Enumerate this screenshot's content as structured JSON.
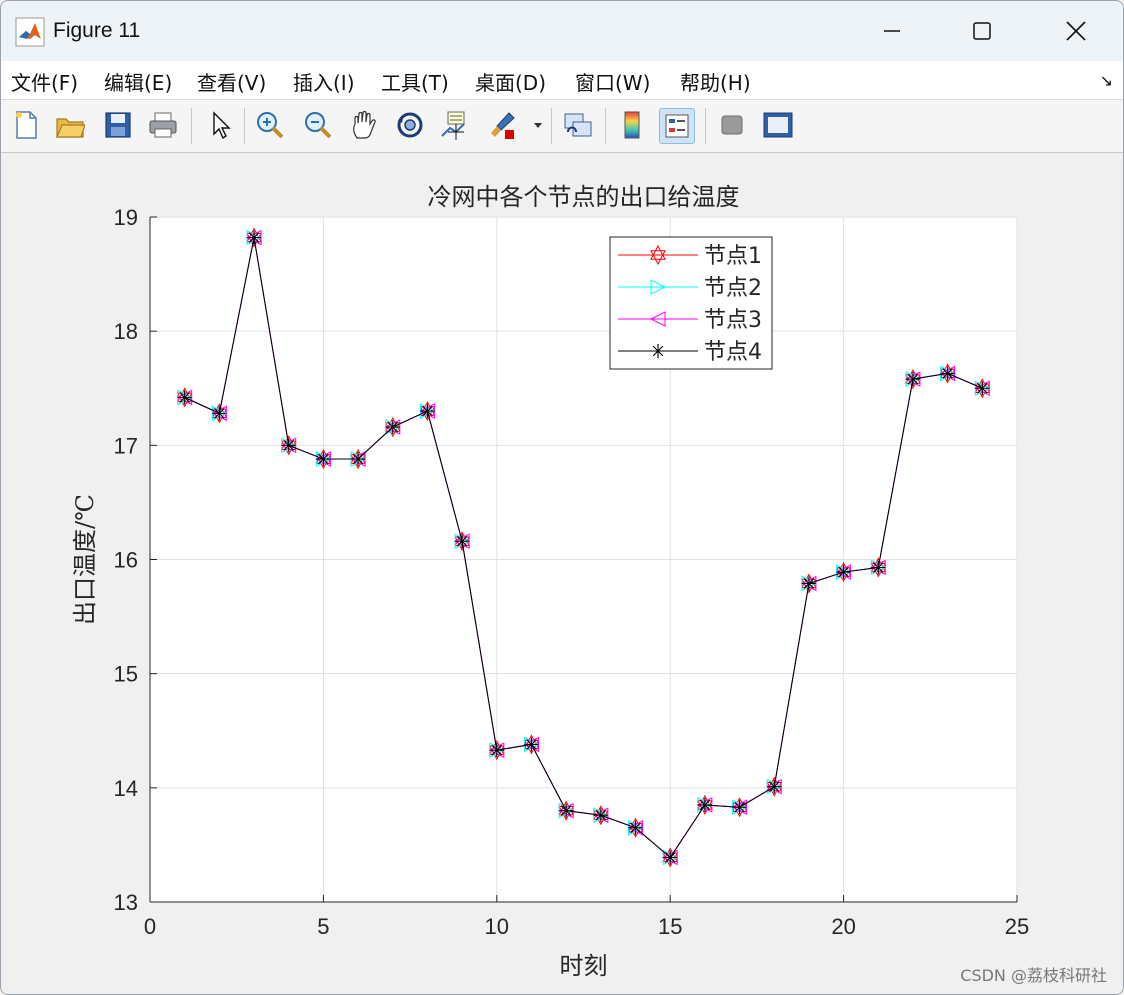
{
  "window": {
    "title": "Figure 11"
  },
  "menu": {
    "items": [
      "文件(F)",
      "编辑(E)",
      "查看(V)",
      "插入(I)",
      "工具(T)",
      "桌面(D)",
      "窗口(W)",
      "帮助(H)"
    ]
  },
  "toolbar": {
    "icons": [
      "new-figure-icon",
      "open-file-icon",
      "save-icon",
      "print-icon",
      "pointer-icon",
      "zoom-in-icon",
      "zoom-out-icon",
      "pan-icon",
      "rotate-3d-icon",
      "data-cursor-icon",
      "brush-icon",
      "link-plot-icon",
      "colorbar-icon",
      "legend-icon",
      "hide-plot-tools-icon",
      "show-plot-tools-icon"
    ]
  },
  "watermark": "CSDN @荔枝科研社",
  "chart_data": {
    "type": "line",
    "title": "冷网中各个节点的出口给温度",
    "xlabel": "时刻",
    "ylabel": "出口温度/℃",
    "xlim": [
      0,
      25
    ],
    "ylim": [
      13,
      19
    ],
    "xticks": [
      0,
      5,
      10,
      15,
      20,
      25
    ],
    "yticks": [
      13,
      14,
      15,
      16,
      17,
      18,
      19
    ],
    "grid": true,
    "legend_position": "top-center",
    "x": [
      1,
      2,
      3,
      4,
      5,
      6,
      7,
      8,
      9,
      10,
      11,
      12,
      13,
      14,
      15,
      16,
      17,
      18,
      19,
      20,
      21,
      22,
      23,
      24
    ],
    "series": [
      {
        "name": "节点1",
        "color": "#ff0000",
        "marker": "hexagram",
        "values": [
          17.42,
          17.28,
          18.82,
          17.0,
          16.88,
          16.88,
          17.16,
          17.3,
          16.16,
          14.33,
          14.38,
          13.8,
          13.76,
          13.65,
          13.39,
          13.85,
          13.83,
          14.01,
          15.79,
          15.89,
          15.93,
          17.58,
          17.63,
          17.5
        ]
      },
      {
        "name": "节点2",
        "color": "#00ffff",
        "marker": "triangle-right",
        "values": [
          17.42,
          17.28,
          18.82,
          17.0,
          16.88,
          16.88,
          17.16,
          17.3,
          16.16,
          14.33,
          14.38,
          13.8,
          13.76,
          13.65,
          13.39,
          13.85,
          13.83,
          14.01,
          15.79,
          15.89,
          15.93,
          17.58,
          17.63,
          17.5
        ]
      },
      {
        "name": "节点3",
        "color": "#ff00ff",
        "marker": "triangle-left",
        "values": [
          17.42,
          17.28,
          18.82,
          17.0,
          16.88,
          16.88,
          17.16,
          17.3,
          16.16,
          14.33,
          14.38,
          13.8,
          13.76,
          13.65,
          13.39,
          13.85,
          13.83,
          14.01,
          15.79,
          15.89,
          15.93,
          17.58,
          17.63,
          17.5
        ]
      },
      {
        "name": "节点4",
        "color": "#000000",
        "marker": "asterisk",
        "values": [
          17.42,
          17.28,
          18.82,
          17.0,
          16.88,
          16.88,
          17.16,
          17.3,
          16.16,
          14.33,
          14.38,
          13.8,
          13.76,
          13.65,
          13.39,
          13.85,
          13.83,
          14.01,
          15.79,
          15.89,
          15.93,
          17.58,
          17.63,
          17.5
        ]
      }
    ]
  }
}
